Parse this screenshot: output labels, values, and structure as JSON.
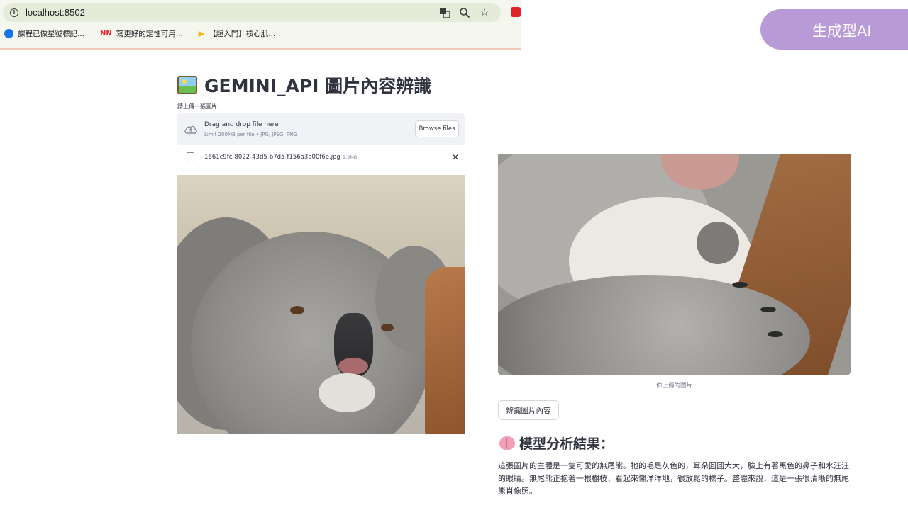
{
  "browser": {
    "url": "localhost:8502",
    "bookmarks": [
      {
        "label": "課程已做星號標記...",
        "icon": "globe-icon",
        "color": "#1a73e8"
      },
      {
        "label": "寫更好的定性可用...",
        "icon": "nn-logo-icon",
        "color": "#e0242c"
      },
      {
        "label": "【超入門】核心肌...",
        "icon": "play-icon",
        "color": "#f4b400"
      }
    ]
  },
  "badge": {
    "label": "生成型AI",
    "color": "#b89ad6"
  },
  "app": {
    "title_icon": "framed-picture-icon",
    "title": "GEMINI_API 圖片內容辨識",
    "uploader": {
      "label": "請上傳一張圖片",
      "drag_text": "Drag and drop file here",
      "limit_text": "Limit 200MB per file • JPG, JPEG, PNG",
      "browse_label": "Browse files"
    },
    "uploaded_file": {
      "name": "1661c9fc-8022-43d5-b7d5-f156a3a00f6e.jpg",
      "size": "1.3MB",
      "remove_icon": "close-icon",
      "remove_label": "✕"
    },
    "image_caption": "你上傳的圖片",
    "recognize_label": "辨識圖片內容",
    "result": {
      "icon": "brain-icon",
      "heading": "模型分析結果：",
      "text": "這張圖片的主體是一隻可愛的無尾熊。牠的毛是灰色的，耳朵圓圓大大，臉上有著黑色的鼻子和水汪汪的眼睛。無尾熊正抱著一根樹枝，看起來懶洋洋地，很放鬆的樣子。整體來說，這是一張很清晰的無尾熊肖像照。"
    }
  }
}
